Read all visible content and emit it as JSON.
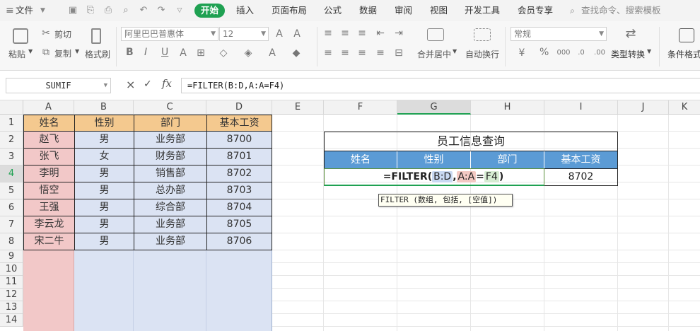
{
  "menu": {
    "file_label": "文件",
    "tabs": [
      "开始",
      "插入",
      "页面布局",
      "公式",
      "数据",
      "审阅",
      "视图",
      "开发工具",
      "会员专享"
    ],
    "search_placeholder": "查找命令、搜索模板"
  },
  "ribbon": {
    "paste": "粘贴",
    "cut": "剪切",
    "copy": "复制",
    "format_painter": "格式刷",
    "font_name": "阿里巴巴普惠体",
    "font_size": "12",
    "bold": "B",
    "italic": "I",
    "underline": "U",
    "merge_center": "合并居中",
    "wrap_text": "自动换行",
    "number_format": "常规",
    "percent": "%",
    "type_convert": "类型转换",
    "conditional_format": "条件格式"
  },
  "formula_bar": {
    "name_box": "SUMIF",
    "cancel": "×",
    "confirm": "✓",
    "fx": "fx",
    "formula": "=FILTER(B:D,A:A=F4)"
  },
  "columns": [
    "A",
    "B",
    "C",
    "D",
    "E",
    "F",
    "G",
    "H",
    "I",
    "J",
    "K"
  ],
  "rows": [
    "1",
    "2",
    "3",
    "4",
    "5",
    "6",
    "7",
    "8",
    "9",
    "10",
    "11",
    "12",
    "13",
    "14"
  ],
  "table": {
    "headers": [
      "姓名",
      "性别",
      "部门",
      "基本工资"
    ],
    "rows": [
      [
        "赵飞",
        "男",
        "业务部",
        "8700"
      ],
      [
        "张飞",
        "女",
        "财务部",
        "8701"
      ],
      [
        "李明",
        "男",
        "销售部",
        "8702"
      ],
      [
        "悟空",
        "男",
        "总办部",
        "8703"
      ],
      [
        "王强",
        "男",
        "综合部",
        "8704"
      ],
      [
        "李云龙",
        "男",
        "业务部",
        "8705"
      ],
      [
        "宋二牛",
        "男",
        "业务部",
        "8706"
      ]
    ]
  },
  "query": {
    "title": "员工信息查询",
    "headers": [
      "姓名",
      "性别",
      "部门",
      "基本工资"
    ],
    "formula_fn": "=FILTER(",
    "arg1": "B:D",
    "comma": ",",
    "arg2": "A:A",
    "eq": "=",
    "arg3": "F4",
    "close": ")",
    "i4_value": "8702"
  },
  "tooltip": "FILTER (数组, 包括, [空值])",
  "colors": {
    "accent": "#1fa152",
    "query_header": "#5b9bd5",
    "name_col": "#f2c8c8",
    "data_col": "#dbe3f3",
    "header_fill": "#f4c98f"
  }
}
